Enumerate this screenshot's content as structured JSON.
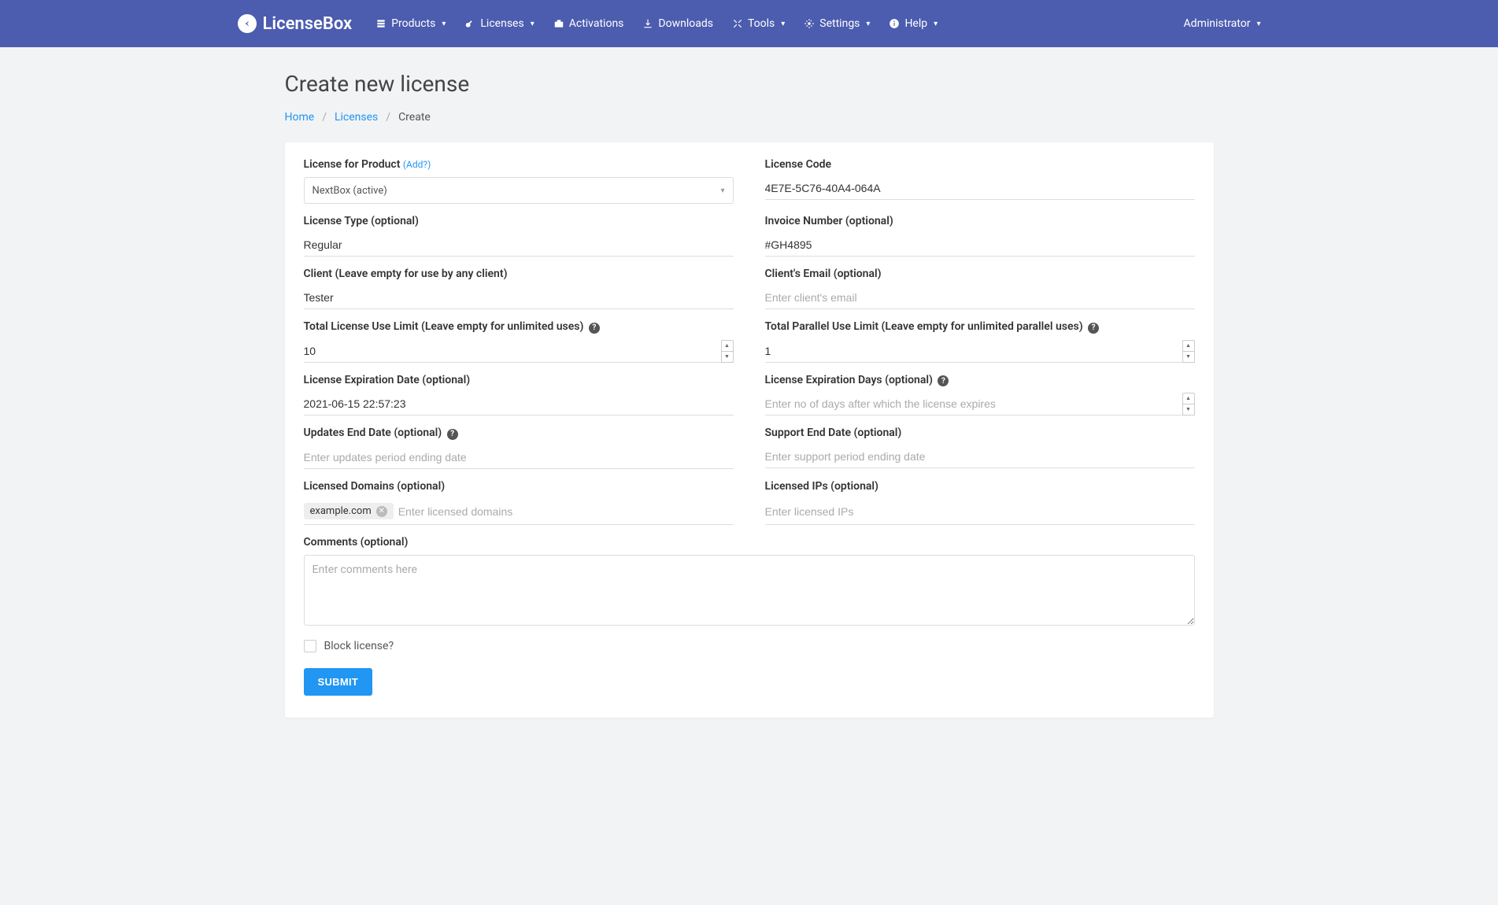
{
  "brand": "LicenseBox",
  "nav": {
    "items": [
      {
        "icon": "layers",
        "label": "Products",
        "dropdown": true
      },
      {
        "icon": "key",
        "label": "Licenses",
        "dropdown": true
      },
      {
        "icon": "bag",
        "label": "Activations",
        "dropdown": false
      },
      {
        "icon": "download",
        "label": "Downloads",
        "dropdown": false
      },
      {
        "icon": "tools",
        "label": "Tools",
        "dropdown": true
      },
      {
        "icon": "gears",
        "label": "Settings",
        "dropdown": true
      },
      {
        "icon": "info",
        "label": "Help",
        "dropdown": true
      }
    ],
    "user": "Administrator"
  },
  "page": {
    "title": "Create new license",
    "breadcrumb": {
      "home": "Home",
      "licenses": "Licenses",
      "current": "Create"
    }
  },
  "form": {
    "product": {
      "label": "License for Product",
      "add_link": "(Add?)",
      "selected": "NextBox (active)"
    },
    "license_code": {
      "label": "License Code",
      "value": "4E7E-5C76-40A4-064A"
    },
    "license_type": {
      "label": "License Type (optional)",
      "value": "Regular"
    },
    "invoice": {
      "label": "Invoice Number (optional)",
      "value": "#GH4895"
    },
    "client": {
      "label": "Client (Leave empty for use by any client)",
      "value": "Tester"
    },
    "client_email": {
      "label": "Client's Email (optional)",
      "placeholder": "Enter client's email",
      "value": ""
    },
    "use_limit": {
      "label": "Total License Use Limit (Leave empty for unlimited uses)",
      "value": "10"
    },
    "parallel_limit": {
      "label": "Total Parallel Use Limit (Leave empty for unlimited parallel uses)",
      "value": "1"
    },
    "exp_date": {
      "label": "License Expiration Date (optional)",
      "value": "2021-06-15 22:57:23"
    },
    "exp_days": {
      "label": "License Expiration Days (optional)",
      "placeholder": "Enter no of days after which the license expires",
      "value": ""
    },
    "updates_end": {
      "label": "Updates End Date (optional)",
      "placeholder": "Enter updates period ending date",
      "value": ""
    },
    "support_end": {
      "label": "Support End Date (optional)",
      "placeholder": "Enter support period ending date",
      "value": ""
    },
    "domains": {
      "label": "Licensed Domains (optional)",
      "placeholder": "Enter licensed domains",
      "tags": [
        "example.com"
      ]
    },
    "ips": {
      "label": "Licensed IPs (optional)",
      "placeholder": "Enter licensed IPs",
      "tags": []
    },
    "comments": {
      "label": "Comments (optional)",
      "placeholder": "Enter comments here",
      "value": ""
    },
    "block": {
      "label": "Block license?"
    },
    "submit": "SUBMIT"
  }
}
